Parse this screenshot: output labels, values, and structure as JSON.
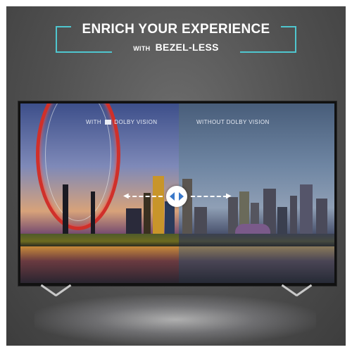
{
  "headline": {
    "line1": "ENRICH YOUR EXPERIENCE",
    "line2_prefix": "WITH",
    "line2_main": "BEZEL-LESS"
  },
  "screen": {
    "left_label_prefix": "WITH",
    "left_label_brand": "DOLBY VISION",
    "right_label": "WITHOUT DOLBY VISION"
  },
  "icons": {
    "compare_slider": "left-right-arrows-icon",
    "dolby": "dolby-logo-icon"
  },
  "colors": {
    "accent": "#4fc6cf",
    "background": "#555555",
    "wheel": "#d0302a"
  }
}
